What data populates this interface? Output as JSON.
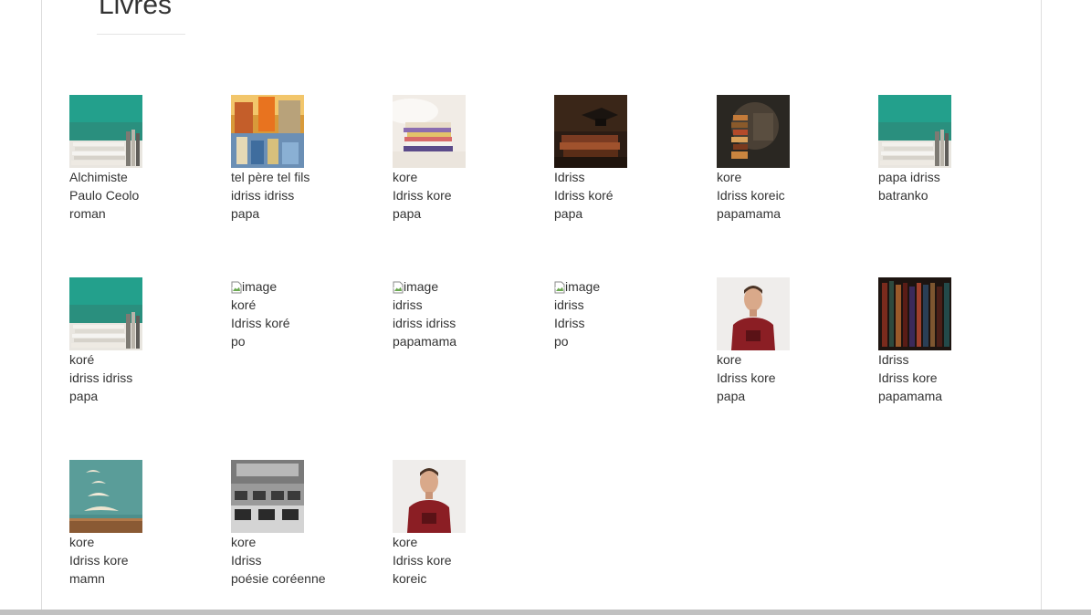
{
  "page": {
    "title": "Livres"
  },
  "books": [
    {
      "title": "Alchimiste",
      "author": "Paulo Ceolo",
      "genre": "roman",
      "image": "books-stack-green"
    },
    {
      "title": "tel père tel fils",
      "author": "idriss idriss",
      "genre": "papa",
      "image": "bookstore-shelves"
    },
    {
      "title": "kore",
      "author": "Idriss kore",
      "genre": "papa",
      "image": "books-on-bed"
    },
    {
      "title": "Idriss",
      "author": "Idriss koré",
      "genre": "papa",
      "image": "graduation-cap-books"
    },
    {
      "title": "kore",
      "author": "Idriss koreic",
      "genre": "papamama",
      "image": "books-head-silhouette"
    },
    {
      "title": "papa idriss",
      "author": "batranko",
      "genre": "",
      "image": "books-stack-green"
    },
    {
      "title": "koré",
      "author": "idriss idriss",
      "genre": "papa",
      "image": "books-stack-green"
    },
    {
      "title": "koré",
      "author": "Idriss koré",
      "genre": "po",
      "image": "broken-image",
      "alt": "image"
    },
    {
      "title": "idriss",
      "author": "idriss idriss",
      "genre": "papamama",
      "image": "broken-image",
      "alt": "image"
    },
    {
      "title": "idriss",
      "author": "Idriss",
      "genre": "po",
      "image": "broken-image",
      "alt": "image"
    },
    {
      "title": "kore",
      "author": "Idriss kore",
      "genre": "papa",
      "image": "man-red-tshirt"
    },
    {
      "title": "Idriss",
      "author": "Idriss kore",
      "genre": "papamama",
      "image": "library-shelves"
    },
    {
      "title": "kore",
      "author": "Idriss kore",
      "genre": "mamn",
      "image": "flying-book-pages"
    },
    {
      "title": "kore",
      "author": "Idriss",
      "genre": "poésie coréenne",
      "image": "classroom-computers"
    },
    {
      "title": "kore",
      "author": "Idriss kore",
      "genre": "koreic",
      "image": "man-red-tshirt"
    }
  ]
}
